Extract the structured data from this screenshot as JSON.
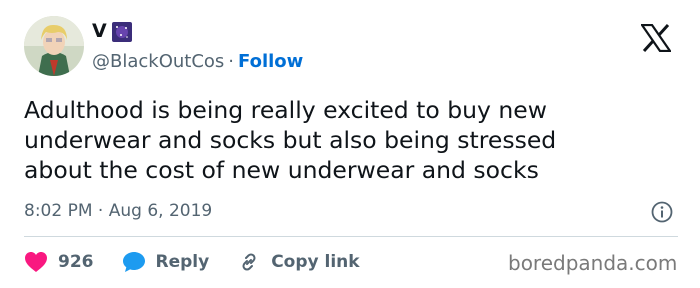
{
  "author": {
    "display_name": "V",
    "handle": "@BlackOutCos",
    "separator": "·",
    "follow_label": "Follow"
  },
  "tweet": {
    "line1": "Adulthood is being really excited to buy new",
    "line2": "underwear and socks but also being stressed",
    "line3": "about the cost of new underwear and socks"
  },
  "meta": {
    "time": "8:02 PM",
    "separator": "·",
    "date": "Aug 6, 2019"
  },
  "actions": {
    "like_count": "926",
    "reply_label": "Reply",
    "copy_link_label": "Copy link"
  },
  "watermark": "boredpanda.com",
  "colors": {
    "like": "#f91880",
    "reply": "#1d9bf0",
    "link": "#006fd6"
  }
}
